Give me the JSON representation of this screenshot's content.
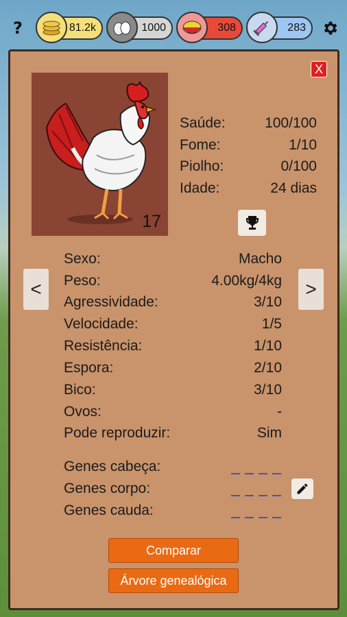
{
  "topbar": {
    "help_label": "?",
    "resources": [
      {
        "name": "coins",
        "icon": "coin-stack-icon",
        "value": "81.2k",
        "color": "#f4e07a"
      },
      {
        "name": "eggs",
        "icon": "eggs-icon",
        "value": "1000",
        "color": "#d6d6d6"
      },
      {
        "name": "food",
        "icon": "food-bowl-icon",
        "value": "308",
        "color": "#e84a3a"
      },
      {
        "name": "medicine",
        "icon": "syringe-icon",
        "value": "283",
        "color": "#9ec6f2"
      }
    ]
  },
  "panel": {
    "close_label": "X",
    "portrait_number": "17",
    "status": [
      {
        "label": "Saúde:",
        "value": "100/100"
      },
      {
        "label": "Fome:",
        "value": "1/10"
      },
      {
        "label": "Piolho:",
        "value": "0/100"
      },
      {
        "label": "Idade:",
        "value": "24 dias"
      }
    ],
    "nav": {
      "prev": "<",
      "next": ">"
    },
    "attributes": [
      {
        "label": "Sexo:",
        "value": "Macho"
      },
      {
        "label": "Peso:",
        "value": "4.00kg/4kg"
      },
      {
        "label": "Agressividade:",
        "value": "3/10"
      },
      {
        "label": "Velocidade:",
        "value": "1/5"
      },
      {
        "label": "Resistência:",
        "value": "1/10"
      },
      {
        "label": "Espora:",
        "value": "2/10"
      },
      {
        "label": "Bico:",
        "value": "3/10"
      },
      {
        "label": "Ovos:",
        "value": "-"
      },
      {
        "label": "Pode reproduzir:",
        "value": "Sim"
      }
    ],
    "genes": [
      {
        "label": "Genes cabeça:"
      },
      {
        "label": "Genes corpo:"
      },
      {
        "label": "Genes cauda:"
      }
    ],
    "buttons": {
      "compare": "Comparar",
      "family_tree": "Árvore genealógica"
    }
  },
  "colors": {
    "panel_bg": "#c9936b",
    "portrait_bg": "#8a4434",
    "button_orange": "#ea6a14",
    "close_red": "#e02020",
    "gene_dash": "#3a56c9"
  }
}
